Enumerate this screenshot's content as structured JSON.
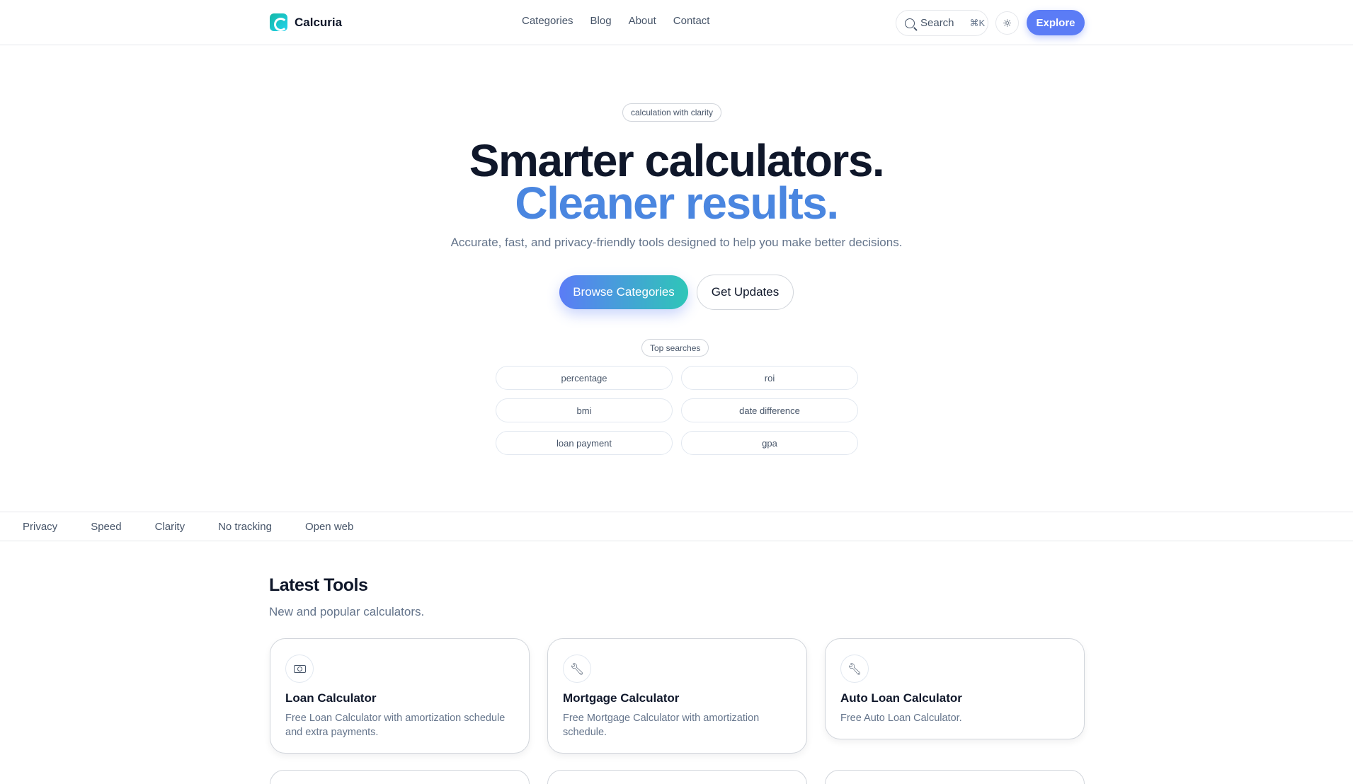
{
  "brand": {
    "name": "Calcuria"
  },
  "nav": {
    "items": [
      "Categories",
      "Blog",
      "About",
      "Contact"
    ]
  },
  "header": {
    "search_label": "Search",
    "search_shortcut": "⌘K",
    "theme_icon": "sun-icon",
    "explore_label": "Explore"
  },
  "hero": {
    "badge": "calculation with clarity",
    "title_line1": "Smarter calculators.",
    "title_line2": "Cleaner results.",
    "subtitle": "Accurate, fast, and privacy-friendly tools designed to help you make better decisions.",
    "primary_cta": "Browse Categories",
    "secondary_cta": "Get Updates",
    "top_searches_label": "Top searches",
    "top_searches": [
      "percentage",
      "roi",
      "bmi",
      "date difference",
      "loan payment",
      "gpa"
    ]
  },
  "strip": {
    "items": [
      "Privacy",
      "Speed",
      "Clarity",
      "No tracking",
      "Open web"
    ]
  },
  "latest": {
    "title": "Latest Tools",
    "subtitle": "New and popular calculators.",
    "cards": [
      {
        "icon": "cash-icon",
        "title": "Loan Calculator",
        "desc": "Free Loan Calculator with amortization schedule and extra payments."
      },
      {
        "icon": "wrench-icon",
        "title": "Mortgage Calculator",
        "desc": "Free Mortgage Calculator with amortization schedule."
      },
      {
        "icon": "wrench-icon",
        "title": "Auto Loan Calculator",
        "desc": "Free Auto Loan Calculator."
      }
    ]
  },
  "colors": {
    "accent": "#5b7cf6",
    "teal": "#2ec6b8",
    "title_blue": "#4a86e0",
    "text": "#0f172a",
    "muted": "#64748b"
  }
}
